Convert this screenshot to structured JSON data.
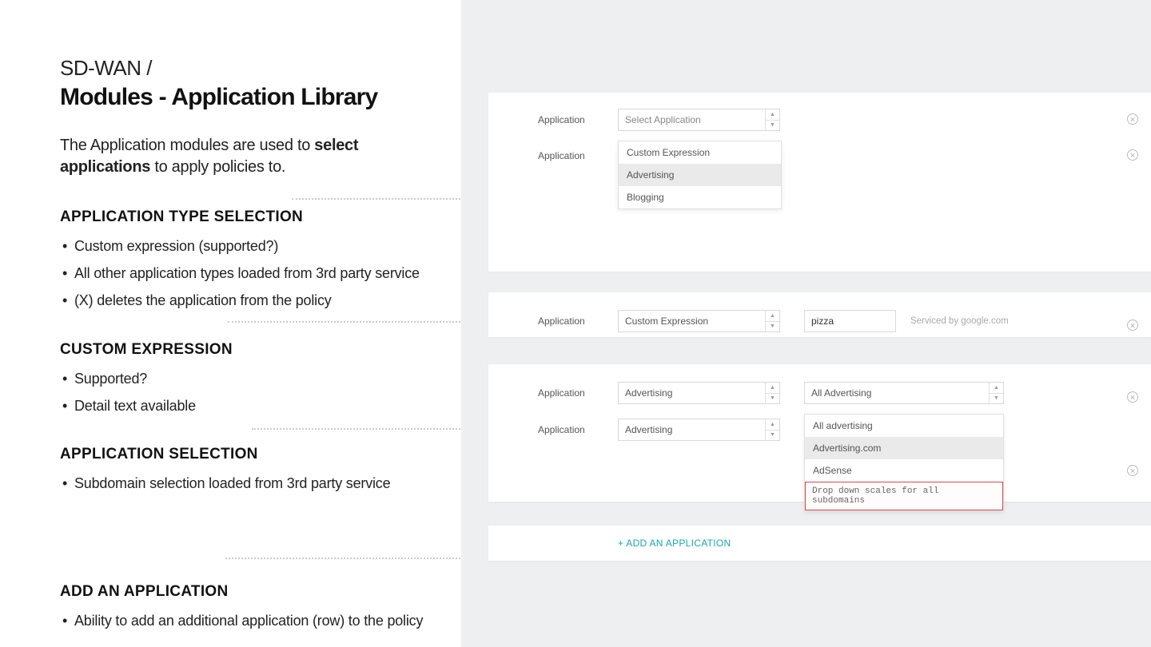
{
  "breadcrumb": "SD-WAN  /",
  "title": "Modules - Application Library",
  "intro_pre": "The Application modules are used to ",
  "intro_bold": "select applications",
  "intro_post": " to apply policies to.",
  "sections": {
    "app_type": {
      "heading": "APPLICATION TYPE SELECTION",
      "b1": "Custom expression (supported?)",
      "b2": "All other application types loaded from 3rd party service",
      "b3": "(X) deletes the application from the policy"
    },
    "custom": {
      "heading": "CUSTOM EXPRESSION",
      "b1": "Supported?",
      "b2": "Detail text available"
    },
    "app_sel": {
      "heading": "APPLICATION SELECTION",
      "b1": "Subdomain selection loaded from 3rd party service"
    },
    "add": {
      "heading": "ADD AN APPLICATION",
      "b1": "Ability to add an additional application (row) to the policy"
    }
  },
  "ui": {
    "row_label": "Application",
    "placeholder_select": "Select Application",
    "dropdown1": {
      "opt1": "Custom Expression",
      "opt2": "Advertising",
      "opt3": "Blogging"
    },
    "custom_expr": {
      "select": "Custom Expression",
      "value": "pizza",
      "hint": "Serviced by google.com"
    },
    "advertising": {
      "select": "Advertising",
      "sub_select": "All Advertising",
      "dd": {
        "o1": "All advertising",
        "o2": "Advertising.com",
        "o3": "AdSense",
        "note": "Drop down scales for all subdomains"
      }
    },
    "add_label": "+ ADD AN APPLICATION"
  }
}
